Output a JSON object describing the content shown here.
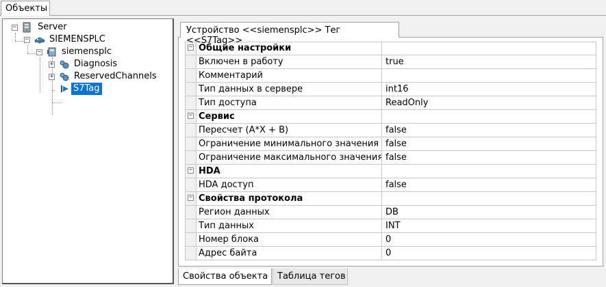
{
  "window": {
    "top_tab_label": "Объекты"
  },
  "tree": {
    "nodes": [
      {
        "label": "Server",
        "icon": "server-icon"
      },
      {
        "label": "SIEMENSPLC",
        "icon": "plc-device-icon"
      },
      {
        "label": "siemensplc",
        "icon": "device-icon"
      },
      {
        "label": "Diagnosis",
        "icon": "folder-group-icon"
      },
      {
        "label": "ReservedChannels",
        "icon": "folder-group-icon"
      },
      {
        "label": "S7Tag",
        "icon": "tag-arrow-icon",
        "selected": true
      }
    ]
  },
  "properties": {
    "tab_label": "Устройство <<siemensplc>> Тег  <<S7Tag>>",
    "rows": [
      {
        "type": "category",
        "name": "Общие настройки",
        "value": ""
      },
      {
        "type": "prop",
        "name": "Включен в работу",
        "value": "true"
      },
      {
        "type": "prop",
        "name": "Комментарий",
        "value": ""
      },
      {
        "type": "prop",
        "name": "Тип данных в сервере",
        "value": "int16"
      },
      {
        "type": "prop",
        "name": "Тип доступа",
        "value": "ReadOnly"
      },
      {
        "type": "category",
        "name": "Сервис",
        "value": ""
      },
      {
        "type": "prop",
        "name": "Пересчет (A*X + B)",
        "value": "false"
      },
      {
        "type": "prop",
        "name": "Ограничение минимального значения",
        "value": "false"
      },
      {
        "type": "prop",
        "name": "Ограничение максимального значения",
        "value": "false"
      },
      {
        "type": "category",
        "name": "HDA",
        "value": ""
      },
      {
        "type": "prop",
        "name": "HDA доступ",
        "value": "false"
      },
      {
        "type": "category",
        "name": "Свойства протокола",
        "value": ""
      },
      {
        "type": "prop",
        "name": "Регион данных",
        "value": "DB"
      },
      {
        "type": "prop",
        "name": "Тип данных",
        "value": "INT"
      },
      {
        "type": "prop",
        "name": "Номер блока",
        "value": "0"
      },
      {
        "type": "prop",
        "name": "Адрес байта",
        "value": "0"
      }
    ]
  },
  "bottom_tabs": {
    "active": "Свойства объекта",
    "inactive": "Таблица тегов"
  },
  "colors": {
    "selection": "#0a74d0",
    "grid_line": "#c8c8c8",
    "window_bg": "#f0f0f0"
  }
}
